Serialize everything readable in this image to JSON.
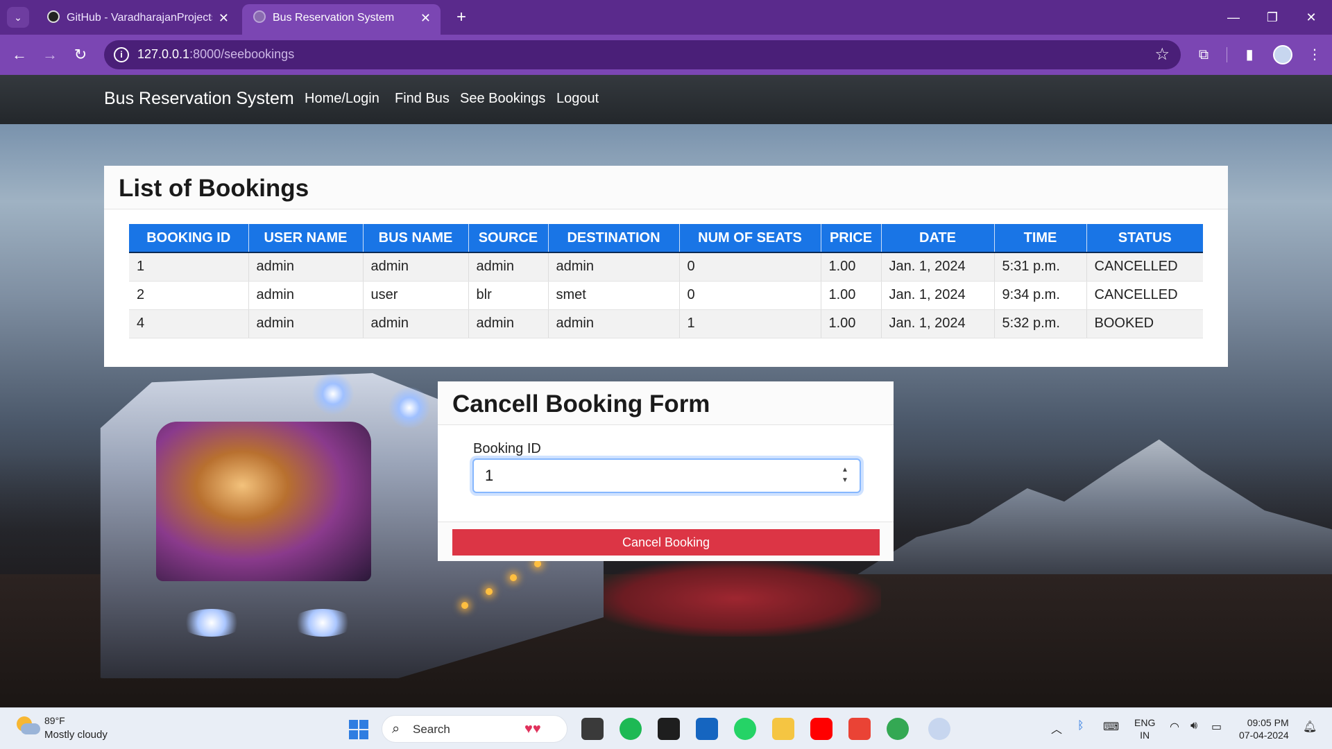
{
  "browser": {
    "tabs": [
      {
        "title": "GitHub - VaradharajanProjects/"
      },
      {
        "title": "Bus Reservation System"
      }
    ],
    "url_host": "127.0.0.1",
    "url_path": ":8000/seebookings"
  },
  "nav": {
    "brand": "Bus Reservation System",
    "links": [
      "Home/Login",
      "Find Bus",
      "See Bookings",
      "Logout"
    ]
  },
  "bookings": {
    "title": "List of Bookings",
    "columns": [
      "BOOKING ID",
      "USER NAME",
      "BUS NAME",
      "SOURCE",
      "DESTINATION",
      "NUM OF SEATS",
      "PRICE",
      "DATE",
      "TIME",
      "STATUS"
    ],
    "rows": [
      [
        "1",
        "admin",
        "admin",
        "admin",
        "admin",
        "0",
        "1.00",
        "Jan. 1, 2024",
        "5:31 p.m.",
        "CANCELLED"
      ],
      [
        "2",
        "admin",
        "user",
        "blr",
        "smet",
        "0",
        "1.00",
        "Jan. 1, 2024",
        "9:34 p.m.",
        "CANCELLED"
      ],
      [
        "4",
        "admin",
        "admin",
        "admin",
        "admin",
        "1",
        "1.00",
        "Jan. 1, 2024",
        "5:32 p.m.",
        "BOOKED"
      ]
    ]
  },
  "cancel_form": {
    "title": "Cancell Booking Form",
    "field_label": "Booking ID",
    "field_value": "1",
    "button_label": "Cancel Booking",
    "button_color": "#dc3545"
  },
  "taskbar": {
    "weather_temp": "89°F",
    "weather_desc": "Mostly cloudy",
    "search_label": "Search",
    "lang_top": "ENG",
    "lang_bottom": "IN",
    "time": "09:05 PM",
    "date": "07-04-2024"
  },
  "colors": {
    "browser_frame": "#7b46b3",
    "table_header": "#1975e6",
    "navbar": "#23272b"
  }
}
